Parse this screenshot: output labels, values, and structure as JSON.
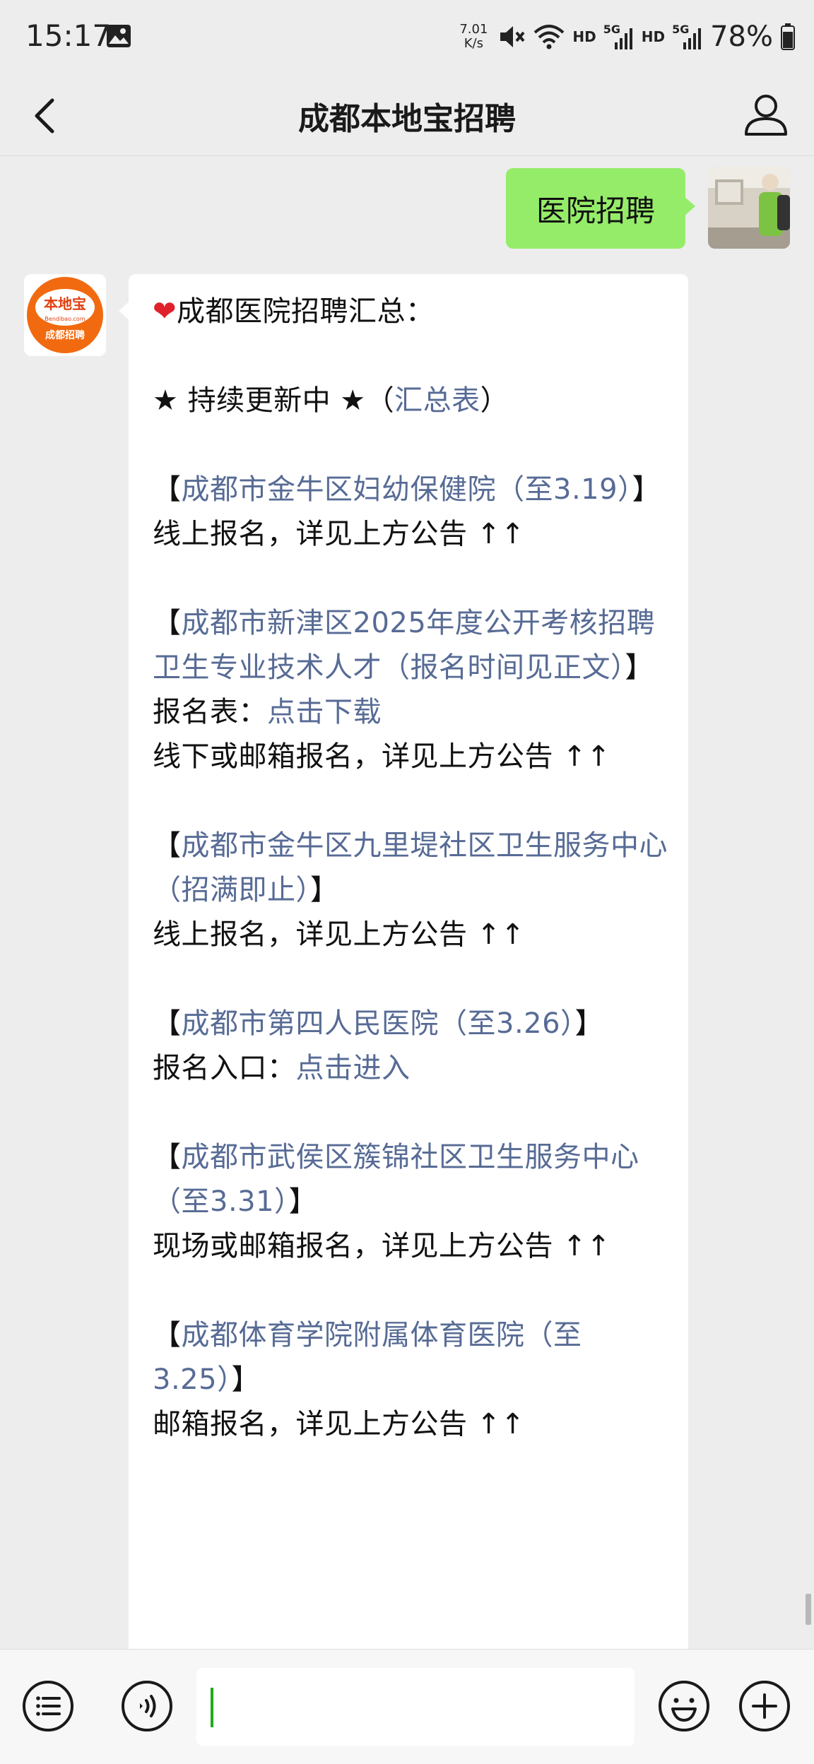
{
  "status_bar": {
    "time": "15:17",
    "net_speed_value": "7.01",
    "net_speed_unit": "K/s",
    "hd_1": "HD",
    "hd_2": "HD",
    "signal_1": "5G",
    "signal_2": "5G",
    "battery": "78%"
  },
  "header": {
    "title": "成都本地宝招聘"
  },
  "chat": {
    "sent_message": "医院招聘",
    "bot_avatar": {
      "logo_text": "本地宝",
      "logo_sub": "Bendibao.com",
      "logo_caption": "成都招聘"
    },
    "reply": {
      "heading": "成都医院招聘汇总：",
      "update_prefix": "★ 持续更新中 ★（",
      "update_link": "汇总表",
      "update_suffix": "）",
      "items": [
        {
          "bracket_open": "【",
          "title": "成都市金牛区妇幼保健院（至3.19）",
          "bracket_close": "】",
          "lines": [
            {
              "text": "线上报名，详见上方公告 ↑↑"
            }
          ]
        },
        {
          "bracket_open": "【",
          "title": "成都市新津区2025年度公开考核招聘卫生专业技术人才（报名时间见正文）",
          "bracket_close": "】",
          "lines": [
            {
              "text": "报名表：",
              "link": "点击下载"
            },
            {
              "text": "线下或邮箱报名，详见上方公告 ↑↑"
            }
          ]
        },
        {
          "bracket_open": "【",
          "title": "成都市金牛区九里堤社区卫生服务中心（招满即止）",
          "bracket_close": "】",
          "lines": [
            {
              "text": "线上报名，详见上方公告 ↑↑"
            }
          ]
        },
        {
          "bracket_open": "【",
          "title": "成都市第四人民医院（至3.26）",
          "bracket_close": "】",
          "lines": [
            {
              "text": "报名入口：",
              "link": "点击进入"
            }
          ]
        },
        {
          "bracket_open": "【",
          "title": "成都市武侯区簇锦社区卫生服务中心（至3.31）",
          "bracket_close": "】",
          "lines": [
            {
              "text": "现场或邮箱报名，详见上方公告 ↑↑"
            }
          ]
        },
        {
          "bracket_open": "【",
          "title": "成都体育学院附属体育医院（至3.25）",
          "bracket_close": "】",
          "lines": [
            {
              "text": "邮箱报名，详见上方公告 ↑↑"
            }
          ]
        }
      ]
    }
  },
  "input_bar": {
    "menu_icon": "list-menu-icon",
    "voice_icon": "voice-icon",
    "emoji_icon": "emoji-icon",
    "plus_icon": "plus-icon"
  },
  "colors": {
    "background": "#ededed",
    "sent_bubble": "#95ec69",
    "link": "#576b95",
    "heart": "#e0202a",
    "caret": "#1aad19",
    "logo_orange": "#f26a10"
  }
}
